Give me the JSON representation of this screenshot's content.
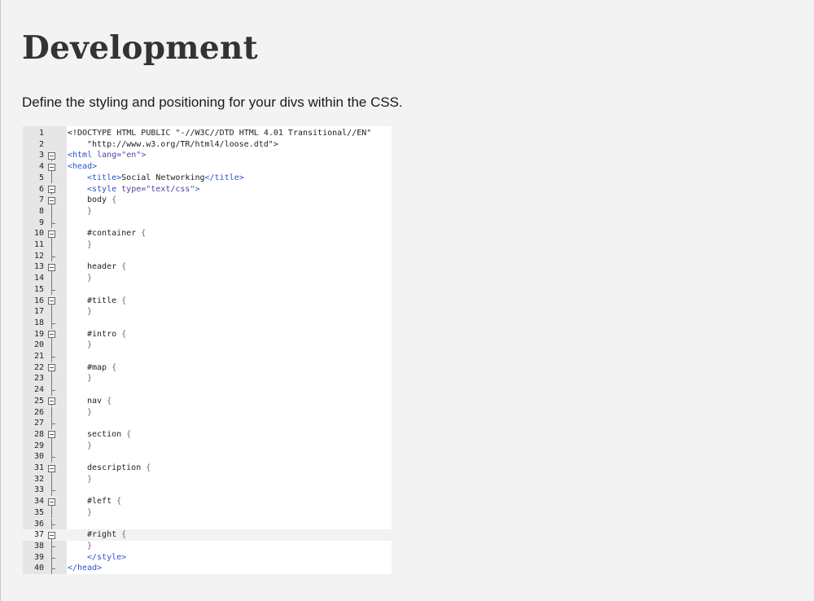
{
  "page": {
    "title": "Development",
    "intro": "Define the styling and positioning for your divs within the CSS."
  },
  "editor": {
    "highlighted_line": 37,
    "lines": [
      {
        "n": "1",
        "indent": 0,
        "fold": "",
        "tokens": [
          {
            "t": "<!DOCTYPE HTML PUBLIC \"-//W3C//DTD HTML 4.01 Transitional//EN\"",
            "c": "doctype"
          }
        ]
      },
      {
        "n": "2",
        "indent": 1,
        "fold": "",
        "tokens": [
          {
            "t": "\"http://www.w3.org/TR/html4/loose.dtd\">",
            "c": "doctype"
          }
        ]
      },
      {
        "n": "3",
        "indent": 0,
        "fold": "box",
        "tokens": [
          {
            "t": "<html ",
            "c": "tag"
          },
          {
            "t": "lang=",
            "c": "attr"
          },
          {
            "t": "\"en\"",
            "c": "str"
          },
          {
            "t": ">",
            "c": "tag"
          }
        ]
      },
      {
        "n": "4",
        "indent": 0,
        "fold": "box",
        "tokens": [
          {
            "t": "<head>",
            "c": "tag"
          }
        ]
      },
      {
        "n": "5",
        "indent": 1,
        "fold": "line",
        "tokens": [
          {
            "t": "<title>",
            "c": "tag"
          },
          {
            "t": "Social Networking",
            "c": "text"
          },
          {
            "t": "</title>",
            "c": "tag"
          }
        ]
      },
      {
        "n": "6",
        "indent": 1,
        "fold": "box",
        "tokens": [
          {
            "t": "<style ",
            "c": "tag"
          },
          {
            "t": "type=",
            "c": "attr"
          },
          {
            "t": "\"text/css\"",
            "c": "str"
          },
          {
            "t": ">",
            "c": "tag"
          }
        ]
      },
      {
        "n": "7",
        "indent": 1,
        "fold": "box",
        "tokens": [
          {
            "t": "body ",
            "c": "sel"
          },
          {
            "t": "{",
            "c": "brace"
          }
        ]
      },
      {
        "n": "8",
        "indent": 1,
        "fold": "line",
        "tokens": [
          {
            "t": "}",
            "c": "brace"
          }
        ]
      },
      {
        "n": "9",
        "indent": 0,
        "fold": "tick",
        "tokens": []
      },
      {
        "n": "10",
        "indent": 1,
        "fold": "box",
        "tokens": [
          {
            "t": "#container ",
            "c": "sel"
          },
          {
            "t": "{",
            "c": "brace"
          }
        ]
      },
      {
        "n": "11",
        "indent": 1,
        "fold": "line",
        "tokens": [
          {
            "t": "}",
            "c": "brace"
          }
        ]
      },
      {
        "n": "12",
        "indent": 0,
        "fold": "tick",
        "tokens": []
      },
      {
        "n": "13",
        "indent": 1,
        "fold": "box",
        "tokens": [
          {
            "t": "header ",
            "c": "sel"
          },
          {
            "t": "{",
            "c": "brace"
          }
        ]
      },
      {
        "n": "14",
        "indent": 1,
        "fold": "line",
        "tokens": [
          {
            "t": "}",
            "c": "brace"
          }
        ]
      },
      {
        "n": "15",
        "indent": 0,
        "fold": "tick",
        "tokens": []
      },
      {
        "n": "16",
        "indent": 1,
        "fold": "box",
        "tokens": [
          {
            "t": "#title ",
            "c": "sel"
          },
          {
            "t": "{",
            "c": "brace"
          }
        ]
      },
      {
        "n": "17",
        "indent": 1,
        "fold": "line",
        "tokens": [
          {
            "t": "}",
            "c": "brace"
          }
        ]
      },
      {
        "n": "18",
        "indent": 0,
        "fold": "tick",
        "tokens": []
      },
      {
        "n": "19",
        "indent": 1,
        "fold": "box",
        "tokens": [
          {
            "t": "#intro ",
            "c": "sel"
          },
          {
            "t": "{",
            "c": "brace"
          }
        ]
      },
      {
        "n": "20",
        "indent": 1,
        "fold": "line",
        "tokens": [
          {
            "t": "}",
            "c": "brace"
          }
        ]
      },
      {
        "n": "21",
        "indent": 0,
        "fold": "tick",
        "tokens": []
      },
      {
        "n": "22",
        "indent": 1,
        "fold": "box",
        "tokens": [
          {
            "t": "#map ",
            "c": "sel"
          },
          {
            "t": "{",
            "c": "brace"
          }
        ]
      },
      {
        "n": "23",
        "indent": 1,
        "fold": "line",
        "tokens": [
          {
            "t": "}",
            "c": "brace"
          }
        ]
      },
      {
        "n": "24",
        "indent": 0,
        "fold": "tick",
        "tokens": []
      },
      {
        "n": "25",
        "indent": 1,
        "fold": "box",
        "tokens": [
          {
            "t": "nav ",
            "c": "sel"
          },
          {
            "t": "{",
            "c": "brace"
          }
        ]
      },
      {
        "n": "26",
        "indent": 1,
        "fold": "line",
        "tokens": [
          {
            "t": "}",
            "c": "brace"
          }
        ]
      },
      {
        "n": "27",
        "indent": 0,
        "fold": "tick",
        "tokens": []
      },
      {
        "n": "28",
        "indent": 1,
        "fold": "box",
        "tokens": [
          {
            "t": "section ",
            "c": "sel"
          },
          {
            "t": "{",
            "c": "brace"
          }
        ]
      },
      {
        "n": "29",
        "indent": 1,
        "fold": "line",
        "tokens": [
          {
            "t": "}",
            "c": "brace"
          }
        ]
      },
      {
        "n": "30",
        "indent": 0,
        "fold": "tick",
        "tokens": []
      },
      {
        "n": "31",
        "indent": 1,
        "fold": "box",
        "tokens": [
          {
            "t": "description ",
            "c": "sel"
          },
          {
            "t": "{",
            "c": "brace"
          }
        ]
      },
      {
        "n": "32",
        "indent": 1,
        "fold": "line",
        "tokens": [
          {
            "t": "}",
            "c": "brace"
          }
        ]
      },
      {
        "n": "33",
        "indent": 0,
        "fold": "tick",
        "tokens": []
      },
      {
        "n": "34",
        "indent": 1,
        "fold": "box",
        "tokens": [
          {
            "t": "#left ",
            "c": "sel"
          },
          {
            "t": "{",
            "c": "brace"
          }
        ]
      },
      {
        "n": "35",
        "indent": 1,
        "fold": "line",
        "tokens": [
          {
            "t": "}",
            "c": "brace"
          }
        ]
      },
      {
        "n": "36",
        "indent": 0,
        "fold": "tick",
        "tokens": []
      },
      {
        "n": "37",
        "indent": 1,
        "fold": "box",
        "tokens": [
          {
            "t": "#right ",
            "c": "sel"
          },
          {
            "t": "{",
            "c": "brace"
          }
        ]
      },
      {
        "n": "38",
        "indent": 1,
        "fold": "tick",
        "tokens": [
          {
            "t": "}",
            "c": "brace"
          }
        ]
      },
      {
        "n": "39",
        "indent": 1,
        "fold": "tick",
        "tokens": [
          {
            "t": "</style>",
            "c": "tag"
          }
        ]
      },
      {
        "n": "40",
        "indent": 0,
        "fold": "tick",
        "tokens": [
          {
            "t": "</head>",
            "c": "tag"
          }
        ]
      }
    ]
  }
}
